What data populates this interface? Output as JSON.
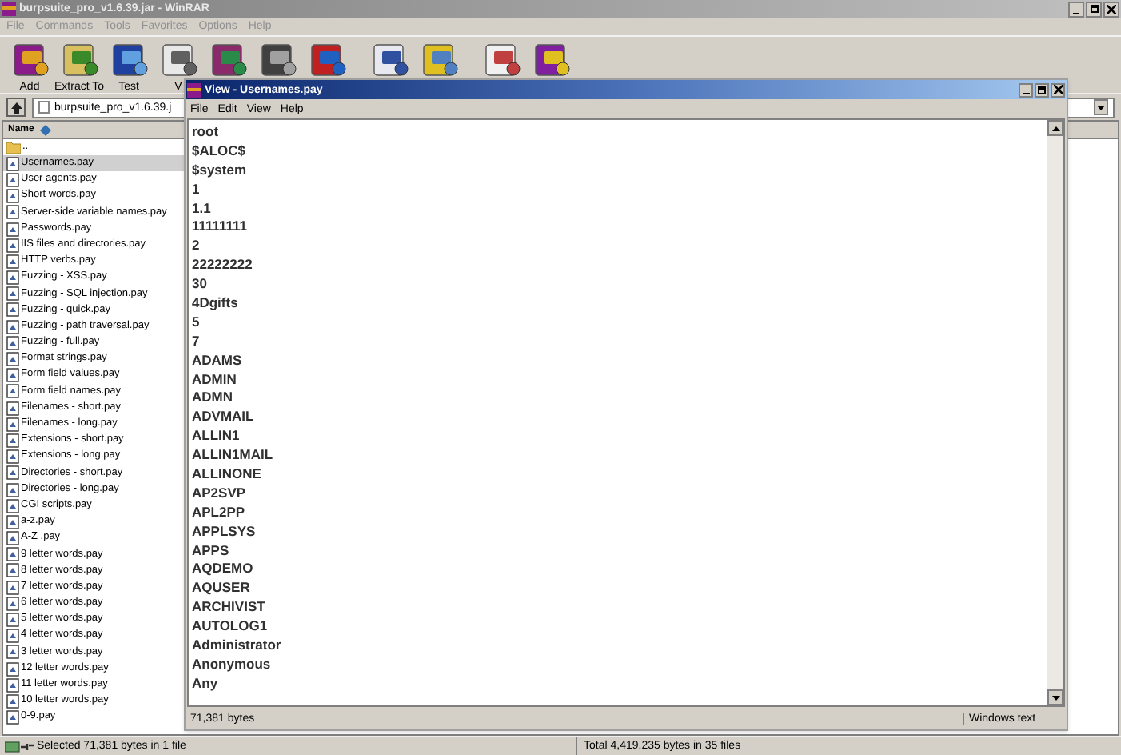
{
  "window": {
    "title": "burpsuite_pro_v1.6.39.jar - WinRAR"
  },
  "menu": [
    "File",
    "Commands",
    "Tools",
    "Favorites",
    "Options",
    "Help"
  ],
  "toolbar_labels": [
    "Add",
    "Extract To",
    "Test",
    "V"
  ],
  "address": "burpsuite_pro_v1.6.39.j",
  "column": "Name",
  "files": [
    {
      "name": "..",
      "kind": "folder",
      "selected": false
    },
    {
      "name": "Usernames.pay",
      "kind": "file",
      "selected": true
    },
    {
      "name": "User agents.pay",
      "kind": "file",
      "selected": false
    },
    {
      "name": "Short words.pay",
      "kind": "file",
      "selected": false
    },
    {
      "name": "Server-side variable names.pay",
      "kind": "file",
      "selected": false
    },
    {
      "name": "Passwords.pay",
      "kind": "file",
      "selected": false
    },
    {
      "name": "IIS files and directories.pay",
      "kind": "file",
      "selected": false
    },
    {
      "name": "HTTP verbs.pay",
      "kind": "file",
      "selected": false
    },
    {
      "name": "Fuzzing - XSS.pay",
      "kind": "file",
      "selected": false
    },
    {
      "name": "Fuzzing - SQL injection.pay",
      "kind": "file",
      "selected": false
    },
    {
      "name": "Fuzzing - quick.pay",
      "kind": "file",
      "selected": false
    },
    {
      "name": "Fuzzing - path traversal.pay",
      "kind": "file",
      "selected": false
    },
    {
      "name": "Fuzzing - full.pay",
      "kind": "file",
      "selected": false
    },
    {
      "name": "Format strings.pay",
      "kind": "file",
      "selected": false
    },
    {
      "name": "Form field values.pay",
      "kind": "file",
      "selected": false
    },
    {
      "name": "Form field names.pay",
      "kind": "file",
      "selected": false
    },
    {
      "name": "Filenames - short.pay",
      "kind": "file",
      "selected": false
    },
    {
      "name": "Filenames - long.pay",
      "kind": "file",
      "selected": false
    },
    {
      "name": "Extensions - short.pay",
      "kind": "file",
      "selected": false
    },
    {
      "name": "Extensions - long.pay",
      "kind": "file",
      "selected": false
    },
    {
      "name": "Directories - short.pay",
      "kind": "file",
      "selected": false
    },
    {
      "name": "Directories - long.pay",
      "kind": "file",
      "selected": false
    },
    {
      "name": "CGI scripts.pay",
      "kind": "file",
      "selected": false
    },
    {
      "name": "a-z.pay",
      "kind": "file",
      "selected": false
    },
    {
      "name": "A-Z .pay",
      "kind": "file",
      "selected": false
    },
    {
      "name": "9 letter words.pay",
      "kind": "file",
      "selected": false
    },
    {
      "name": "8 letter words.pay",
      "kind": "file",
      "selected": false
    },
    {
      "name": "7 letter words.pay",
      "kind": "file",
      "selected": false
    },
    {
      "name": "6 letter words.pay",
      "kind": "file",
      "selected": false
    },
    {
      "name": "5 letter words.pay",
      "kind": "file",
      "selected": false
    },
    {
      "name": "4 letter words.pay",
      "kind": "file",
      "selected": false
    },
    {
      "name": "3 letter words.pay",
      "kind": "file",
      "selected": false
    },
    {
      "name": "12 letter words.pay",
      "kind": "file",
      "selected": false
    },
    {
      "name": "11 letter words.pay",
      "kind": "file",
      "selected": false
    },
    {
      "name": "10 letter words.pay",
      "kind": "file",
      "selected": false
    },
    {
      "name": "0-9.pay",
      "kind": "file",
      "selected": false
    }
  ],
  "status_bar": {
    "left": "Selected 71,381 bytes in 1 file",
    "right": "Total 4,419,235 bytes in 35 files"
  },
  "viewer": {
    "title": "View - Usernames.pay",
    "menu": [
      "File",
      "Edit",
      "View",
      "Help"
    ],
    "lines": [
      "root",
      "$ALOC$",
      "$system",
      "1",
      "1.1",
      "11111111",
      "2",
      "22222222",
      "30",
      "4Dgifts",
      "5",
      "7",
      "ADAMS",
      "ADMIN",
      "ADMN",
      "ADVMAIL",
      "ALLIN1",
      "ALLIN1MAIL",
      "ALLINONE",
      "AP2SVP",
      "APL2PP",
      "APPLSYS",
      "APPS",
      "AQDEMO",
      "AQUSER",
      "ARCHIVIST",
      "AUTOLOG1",
      "Administrator",
      "Anonymous",
      "Any"
    ],
    "status": [
      "71,381 bytes",
      "Windows text"
    ]
  }
}
